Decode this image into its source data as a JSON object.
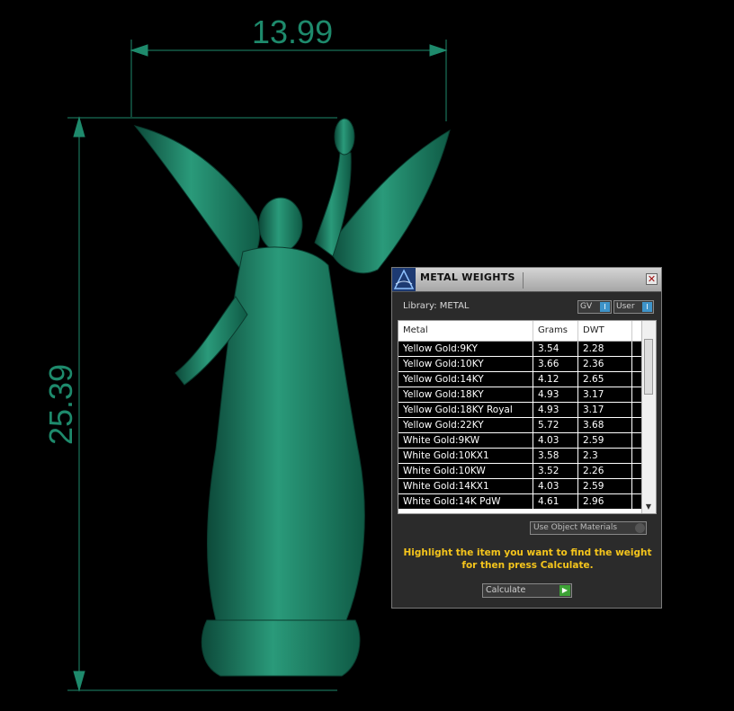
{
  "dimensions": {
    "width": "13.99",
    "height": "25.39"
  },
  "colors": {
    "statue": "#1f7b62",
    "dimension_line": "#1e8a6c",
    "instruction_text": "#f5c51c",
    "selection": "#000000"
  },
  "panel": {
    "title": "METAL WEIGHTS",
    "close_glyph": "✕",
    "library_label": "Library: METAL",
    "toggles": [
      {
        "label": "GV",
        "glyph": "I"
      },
      {
        "label": "User",
        "glyph": "I"
      }
    ],
    "table": {
      "headers": [
        "Metal",
        "Grams",
        "DWT"
      ],
      "rows": [
        {
          "metal": "Yellow Gold:9KY",
          "grams": "3.54",
          "dwt": "2.28"
        },
        {
          "metal": "Yellow Gold:10KY",
          "grams": "3.66",
          "dwt": "2.36"
        },
        {
          "metal": "Yellow Gold:14KY",
          "grams": "4.12",
          "dwt": "2.65"
        },
        {
          "metal": "Yellow Gold:18KY",
          "grams": "4.93",
          "dwt": "3.17"
        },
        {
          "metal": "Yellow Gold:18KY Royal",
          "grams": "4.93",
          "dwt": "3.17"
        },
        {
          "metal": "Yellow Gold:22KY",
          "grams": "5.72",
          "dwt": "3.68"
        },
        {
          "metal": "White Gold:9KW",
          "grams": "4.03",
          "dwt": "2.59"
        },
        {
          "metal": "White Gold:10KX1",
          "grams": "3.58",
          "dwt": "2.3"
        },
        {
          "metal": "White Gold:10KW",
          "grams": "3.52",
          "dwt": "2.26"
        },
        {
          "metal": "White Gold:14KX1",
          "grams": "4.03",
          "dwt": "2.59"
        },
        {
          "metal": "White Gold:14K PdW",
          "grams": "4.61",
          "dwt": "2.96"
        }
      ]
    },
    "use_object_materials_label": "Use Object Materials",
    "instructions": "Highlight the item you want to find the weight for then press Calculate.",
    "calculate_label": "Calculate",
    "calculate_glyph": "▶",
    "scroll_glyph": "▼"
  }
}
